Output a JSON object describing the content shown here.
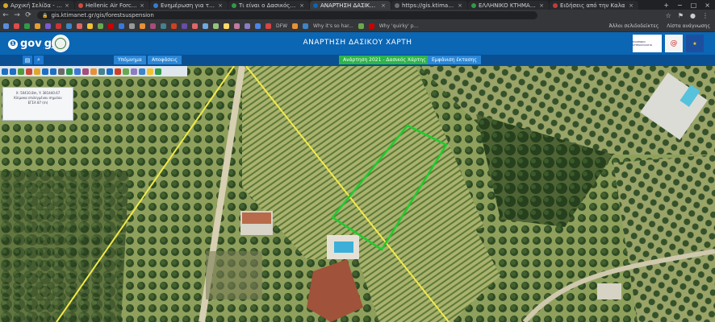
{
  "browser": {
    "tabs": [
      {
        "label": "Αρχική Σελίδα - Πολεμ",
        "color": "#d4a72c",
        "active": false
      },
      {
        "label": "Hellenic Air Force - Π",
        "color": "#d14b3b",
        "active": false
      },
      {
        "label": "Ενημέρωση για τους Δ",
        "color": "#3b7ad1",
        "active": false
      },
      {
        "label": "Τι είναι ο Δασικός Χάρτ",
        "color": "#2f9a4a",
        "active": false
      },
      {
        "label": "ΑΝΑΡΤΗΣΗ ΔΑΣΙΚΟΥ Χ",
        "color": "#0b66b4",
        "active": true
      },
      {
        "label": "https://gis.ktimanet.g",
        "color": "#6c6c6c",
        "active": false
      },
      {
        "label": "ΕΛΛΗΝΙΚΟ ΚΤΗΜΑΤΟΛ",
        "color": "#2f9a4a",
        "active": false
      },
      {
        "label": "Ειδήσεις από την Καλα",
        "color": "#c23b3b",
        "active": false
      }
    ],
    "url": "gis.ktimanet.gr/gis/forestsuspension",
    "bookmarks_right": [
      "Άλλοι σελιδοδείκτες",
      "Λίστα ανάγνωσης"
    ],
    "bookmark_texts": [
      "DFW",
      "Why it's so har...",
      "Why 'quirky' p..."
    ]
  },
  "header": {
    "brand": "gov",
    "brand_suffix": "gr",
    "title": "ΑΝΑΡΤΗΣΗ ΔΑΣΙΚΟΥ ΧΑΡΤΗ",
    "logo_right_1": "ΕΛΛΗΝΙΚΟ ΚΤΗΜΑΤΟΛΟΓΙΟ"
  },
  "toolbar": {
    "btn_legend": "Υπόμνημα",
    "btn_decisions": "Αποφάσεις",
    "layer_select": "Ανάρτηση 2021 - Δασικός Χάρτης",
    "btn_show_area": "Εμφάνιση έκτασης"
  },
  "infobox": {
    "line1": "Χ: 50410.8m, Y: 381440.67",
    "line2": "Κλίμακα επιλεγμένου σημείου",
    "line3": "ΕΓΣΑ 87 (m)"
  },
  "colors": {
    "gov_blue": "#0b66b4",
    "boundary_yellow": "#f2e94a",
    "parcel_green": "#1ecb2f"
  }
}
